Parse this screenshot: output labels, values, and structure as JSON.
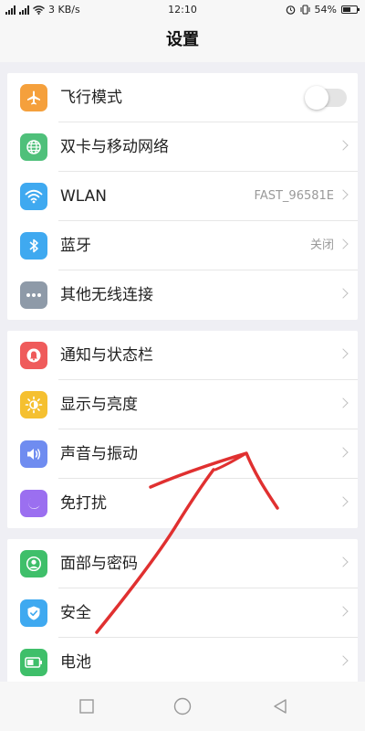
{
  "status_bar": {
    "network_speed": "3 KB/s",
    "time": "12:10",
    "battery": "54%",
    "battery_level": 0.54
  },
  "header": {
    "title": "设置"
  },
  "groups": [
    {
      "items": [
        {
          "label": "飞行模式",
          "icon": "airplane-icon",
          "color": "#f5a03c",
          "control": "toggle",
          "toggle_on": false
        },
        {
          "label": "双卡与移动网络",
          "icon": "globe-icon",
          "color": "#4fc07a"
        },
        {
          "label": "WLAN",
          "icon": "wifi-icon",
          "color": "#3fa9f0",
          "value": "FAST_96581E"
        },
        {
          "label": "蓝牙",
          "icon": "bluetooth-icon",
          "color": "#3fa9f0",
          "value": "关闭"
        },
        {
          "label": "其他无线连接",
          "icon": "more-dots-icon",
          "color": "#8e9aa8"
        }
      ]
    },
    {
      "items": [
        {
          "label": "通知与状态栏",
          "icon": "notification-icon",
          "color": "#ef5b5b"
        },
        {
          "label": "显示与亮度",
          "icon": "brightness-icon",
          "color": "#f5c030"
        },
        {
          "label": "声音与振动",
          "icon": "speaker-icon",
          "color": "#6f8cf0"
        },
        {
          "label": "免打扰",
          "icon": "moon-icon",
          "color": "#9b6ff0"
        }
      ]
    },
    {
      "items": [
        {
          "label": "面部与密码",
          "icon": "face-id-icon",
          "color": "#3fbf6a"
        },
        {
          "label": "安全",
          "icon": "shield-icon",
          "color": "#3fa9f0"
        },
        {
          "label": "电池",
          "icon": "battery-icon",
          "color": "#3fbf6a"
        }
      ]
    }
  ],
  "nav_bar": {
    "buttons": [
      "recent-apps-icon",
      "home-icon",
      "back-icon"
    ]
  },
  "annotation": {
    "color": "#e03030",
    "type": "hand-drawn-arrow"
  }
}
